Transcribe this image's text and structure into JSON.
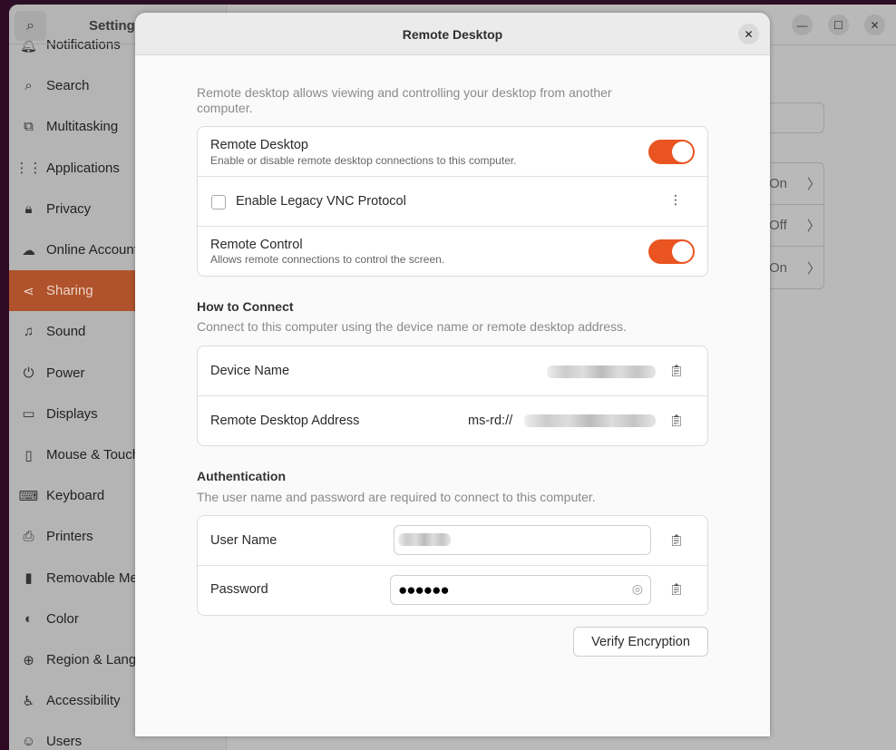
{
  "settings": {
    "title": "Settings",
    "sidebar": [
      {
        "label": "Notifications",
        "icon": "bell-icon"
      },
      {
        "label": "Search",
        "icon": "search-icon"
      },
      {
        "label": "Multitasking",
        "icon": "multitasking-icon"
      },
      {
        "label": "Applications",
        "icon": "apps-grid-icon"
      },
      {
        "label": "Privacy",
        "icon": "lock-icon"
      },
      {
        "label": "Online Accounts",
        "icon": "cloud-icon"
      },
      {
        "label": "Sharing",
        "icon": "share-icon",
        "active": true
      },
      {
        "label": "Sound",
        "icon": "music-note-icon"
      },
      {
        "label": "Power",
        "icon": "power-icon"
      },
      {
        "label": "Displays",
        "icon": "display-icon"
      },
      {
        "label": "Mouse & Touchpad",
        "icon": "mouse-icon"
      },
      {
        "label": "Keyboard",
        "icon": "keyboard-icon"
      },
      {
        "label": "Printers",
        "icon": "printer-icon"
      },
      {
        "label": "Removable Media",
        "icon": "usb-icon"
      },
      {
        "label": "Color",
        "icon": "color-icon"
      },
      {
        "label": "Region & Language",
        "icon": "globe-icon"
      },
      {
        "label": "Accessibility",
        "icon": "accessibility-icon"
      },
      {
        "label": "Users",
        "icon": "users-icon"
      }
    ],
    "background_rows": [
      "On",
      "Off",
      "On"
    ]
  },
  "dialog": {
    "title": "Remote Desktop",
    "intro": "Remote desktop allows viewing and controlling your desktop from another computer.",
    "remote_desktop": {
      "label": "Remote Desktop",
      "sub": "Enable or disable remote desktop connections to this computer.",
      "enabled": true
    },
    "legacy_vnc": {
      "label": "Enable Legacy VNC Protocol",
      "checked": false
    },
    "remote_control": {
      "label": "Remote Control",
      "sub": "Allows remote connections to control the screen.",
      "enabled": true
    },
    "how_to_connect": {
      "heading": "How to Connect",
      "desc": "Connect to this computer using the device name or remote desktop address.",
      "device_name_label": "Device Name",
      "address_label": "Remote Desktop Address",
      "address_prefix": "ms-rd://"
    },
    "authentication": {
      "heading": "Authentication",
      "desc": "The user name and password are required to connect to this computer.",
      "username_label": "User Name",
      "password_label": "Password",
      "password_mask": "●●●●●●"
    },
    "verify_button": "Verify Encryption",
    "accent": "#e95420"
  }
}
